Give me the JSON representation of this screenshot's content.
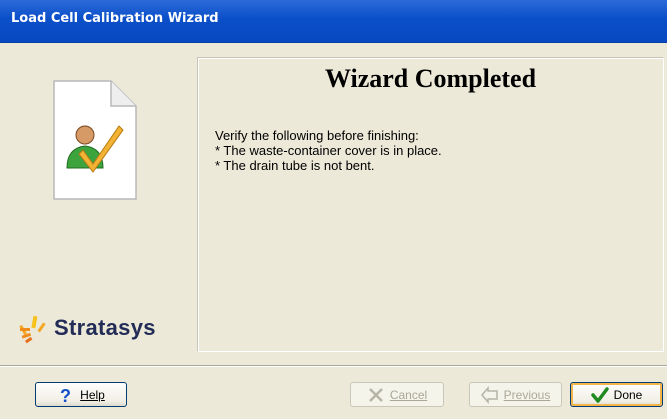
{
  "window": {
    "title": "Load Cell Calibration Wizard"
  },
  "brand": {
    "name": "Stratasys",
    "color": "#232c57",
    "accent": "#f5a623"
  },
  "content": {
    "heading": "Wizard Completed",
    "lines": [
      "Verify the following before finishing:",
      "* The waste-container cover is in place.",
      "* The drain tube is not bent."
    ]
  },
  "buttons": {
    "help": {
      "label": "Help",
      "icon": "question-icon",
      "enabled": true
    },
    "cancel": {
      "label": "Cancel",
      "icon": "x-icon",
      "enabled": false
    },
    "previous": {
      "label": "Previous",
      "icon": "arrow-left-icon",
      "enabled": false
    },
    "done": {
      "label": "Done",
      "icon": "checkmark-icon",
      "enabled": true,
      "default": true
    }
  },
  "colors": {
    "titlebar": "#0a4fc9",
    "dialog_bg": "#ece9d8",
    "check_green": "#1f8a1f"
  }
}
